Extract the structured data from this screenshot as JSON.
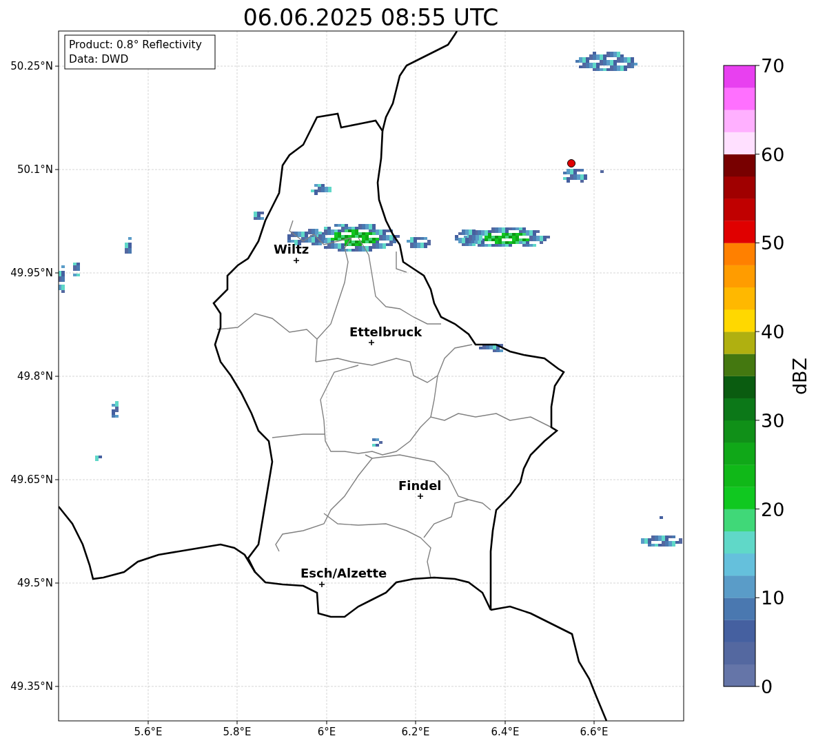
{
  "title": "06.06.2025 08:55 UTC",
  "info_box": {
    "lines": [
      "Product: 0.8° Reflectivity",
      "Data: DWD"
    ]
  },
  "map": {
    "lon_ticks": [
      "5.6°E",
      "5.8°E",
      "6°E",
      "6.2°E",
      "6.4°E",
      "6.6°E"
    ],
    "lat_ticks": [
      "50.25°N",
      "50.1°N",
      "49.95°N",
      "49.8°N",
      "49.65°N",
      "49.5°N",
      "49.35°N"
    ],
    "cities": [
      {
        "name": "Wiltz"
      },
      {
        "name": "Ettelbruck"
      },
      {
        "name": "Findel"
      },
      {
        "name": "Esch/Alzette"
      }
    ]
  },
  "colorbar": {
    "label": "dBZ",
    "ticks": [
      "70",
      "60",
      "50",
      "40",
      "30",
      "20",
      "10",
      "0"
    ],
    "segments": [
      {
        "color": "#6575a8"
      },
      {
        "color": "#5468a0"
      },
      {
        "color": "#4560a0"
      },
      {
        "color": "#4a78b0"
      },
      {
        "color": "#5a9cc8"
      },
      {
        "color": "#65c0dc"
      },
      {
        "color": "#60d8c8"
      },
      {
        "color": "#40d878"
      },
      {
        "color": "#10c820"
      },
      {
        "color": "#10b818"
      },
      {
        "color": "#10a818"
      },
      {
        "color": "#109018"
      },
      {
        "color": "#0c7818"
      },
      {
        "color": "#0a5c10"
      },
      {
        "color": "#447810"
      },
      {
        "color": "#b0b010"
      },
      {
        "color": "#ffd800"
      },
      {
        "color": "#ffb800"
      },
      {
        "color": "#ff9c00"
      },
      {
        "color": "#ff8000"
      },
      {
        "color": "#e00000"
      },
      {
        "color": "#c00000"
      },
      {
        "color": "#a00000"
      },
      {
        "color": "#780000"
      },
      {
        "color": "#ffe0ff"
      },
      {
        "color": "#ffb0ff"
      },
      {
        "color": "#ff70ff"
      },
      {
        "color": "#e840f0"
      }
    ]
  }
}
